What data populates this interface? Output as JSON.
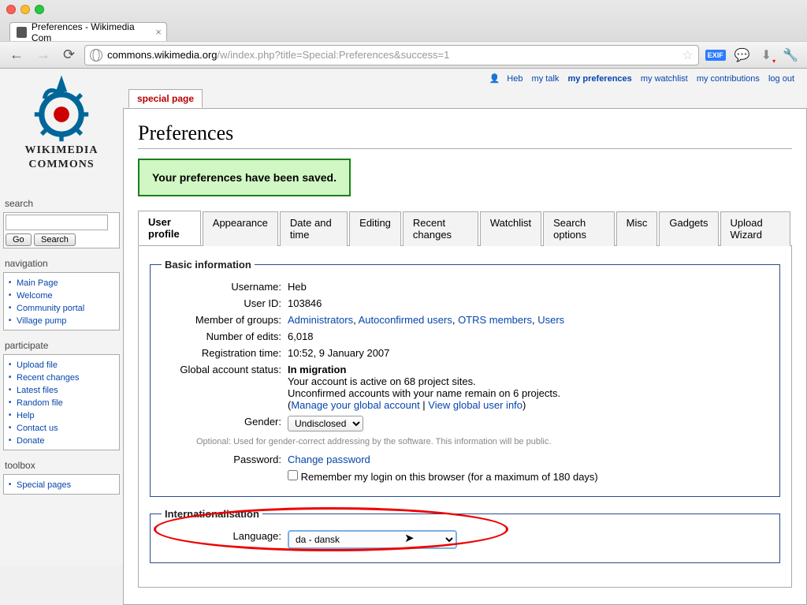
{
  "browser": {
    "tab_title": "Preferences - Wikimedia Com",
    "url_domain": "commons.wikimedia.org",
    "url_path": "/w/index.php?title=Special:Preferences&success=1",
    "exif_badge": "EXIF"
  },
  "toplinks": {
    "user": "Heb",
    "talk": "my talk",
    "prefs": "my preferences",
    "watch": "my watchlist",
    "contrib": "my contributions",
    "logout": "log out"
  },
  "logo": {
    "line1": "WIKIMEDIA",
    "line2": "COMMONS"
  },
  "sidebar": {
    "search_head": "search",
    "go": "Go",
    "search": "Search",
    "nav_head": "navigation",
    "nav": [
      "Main Page",
      "Welcome",
      "Community portal",
      "Village pump"
    ],
    "part_head": "participate",
    "part": [
      "Upload file",
      "Recent changes",
      "Latest files",
      "Random file",
      "Help",
      "Contact us",
      "Donate"
    ],
    "tool_head": "toolbox",
    "tool": [
      "Special pages"
    ]
  },
  "special_tab": "special page",
  "heading": "Preferences",
  "alert": "Your preferences have been saved.",
  "tabs": [
    "User profile",
    "Appearance",
    "Date and time",
    "Editing",
    "Recent changes",
    "Watchlist",
    "Search options",
    "Misc",
    "Gadgets",
    "Upload Wizard"
  ],
  "basic": {
    "legend": "Basic information",
    "username_lbl": "Username:",
    "username": "Heb",
    "userid_lbl": "User ID:",
    "userid": "103846",
    "groups_lbl": "Member of groups:",
    "group1": "Administrators",
    "group2": "Autoconfirmed users",
    "group3": "OTRS members",
    "group4": "Users",
    "edits_lbl": "Number of edits:",
    "edits": "6,018",
    "reg_lbl": "Registration time:",
    "reg": "10:52, 9 January 2007",
    "gstatus_lbl": "Global account status:",
    "gstatus": "In migration",
    "gstatus_l1": "Your account is active on 68 project sites.",
    "gstatus_l2": "Unconfirmed accounts with your name remain on 6 projects.",
    "manage": "Manage your global account",
    "view": "View global user info",
    "gender_lbl": "Gender:",
    "gender_sel": "Undisclosed",
    "gender_hint": "Optional: Used for gender-correct addressing by the software. This information will be public.",
    "pw_lbl": "Password:",
    "pw_link": "Change password",
    "remember": "Remember my login on this browser (for a maximum of 180 days)"
  },
  "intl": {
    "legend": "Internationalisation",
    "lang_lbl": "Language:",
    "lang_sel": "da - dansk"
  }
}
